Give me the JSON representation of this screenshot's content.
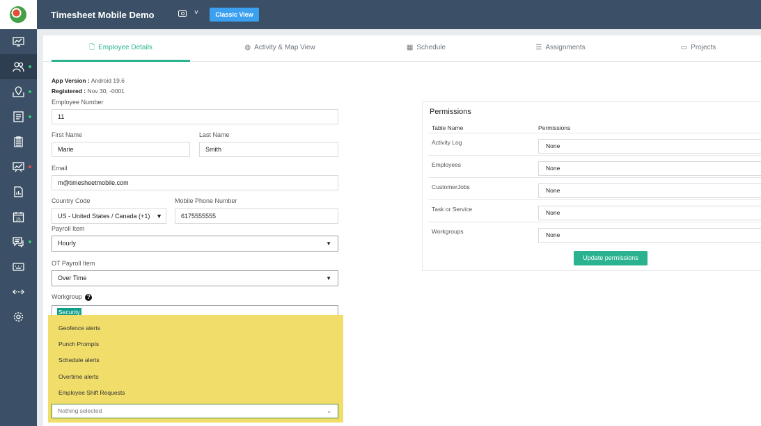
{
  "header": {
    "app_title": "Timesheet Mobile Demo",
    "caret": "˅",
    "classic_view_label": "Classic View"
  },
  "sidebar": {
    "items": [
      {
        "icon": "dashboard-icon",
        "dot": null
      },
      {
        "icon": "employees-icon",
        "dot": "#2ecc71",
        "active": true
      },
      {
        "icon": "map-icon",
        "dot": "#2ecc71"
      },
      {
        "icon": "documents-icon",
        "dot": "#2ecc71"
      },
      {
        "icon": "clipboard-icon",
        "dot": null
      },
      {
        "icon": "chart-icon",
        "dot": "#e84c4c"
      },
      {
        "icon": "report-icon",
        "dot": null
      },
      {
        "icon": "calendar-icon",
        "dot": null
      },
      {
        "icon": "messages-icon",
        "dot": "#2ecc71"
      },
      {
        "icon": "keyboard-icon",
        "dot": null
      },
      {
        "icon": "transfer-icon",
        "dot": null
      },
      {
        "icon": "settings-icon",
        "dot": null
      }
    ],
    "calendar_number": "15"
  },
  "tabs": [
    {
      "label": "Employee Details",
      "icon": "document-icon",
      "active": true
    },
    {
      "label": "Activity & Map View",
      "icon": "globe-icon",
      "active": false
    },
    {
      "label": "Schedule",
      "icon": "calendar-icon",
      "active": false
    },
    {
      "label": "Assignments",
      "icon": "list-icon",
      "active": false
    },
    {
      "label": "Projects",
      "icon": "projects-icon",
      "active": false
    }
  ],
  "employee": {
    "app_version_label": "App Version :",
    "app_version_value": "Android 19.6",
    "registered_label": "Registered :",
    "registered_value": "Nov 30, -0001",
    "employee_number_label": "Employee Number",
    "employee_number_value": "11",
    "first_name_label": "First Name",
    "first_name_value": "Marie",
    "last_name_label": "Last Name",
    "last_name_value": "Smith",
    "email_label": "Email",
    "email_value": "m@timesheetmobile.com",
    "country_code_label": "Country Code",
    "country_code_value": "US - United States / Canada (+1)",
    "mobile_label": "Mobile Phone Number",
    "mobile_value": "6175555555",
    "payroll_item_label": "Payroll Item",
    "payroll_item_value": "Hourly",
    "ot_payroll_item_label": "OT Payroll Item",
    "ot_payroll_item_value": "Over Time",
    "workgroup_label": "Workgroup",
    "workgroup_tag": "Security",
    "help_glyph": "?"
  },
  "alerts_dropdown": {
    "options": [
      "Geofence alerts",
      "Punch Prompts",
      "Schedule alerts",
      "Overtime alerts",
      "Employee Shift Requests"
    ],
    "selected_text": "Nothing selected",
    "highlight_color": "#f0dd6a"
  },
  "permissions": {
    "title": "Permissions",
    "col_table_name": "Table Name",
    "col_permissions": "Permissions",
    "rows": [
      {
        "name": "Activity Log",
        "value": "None"
      },
      {
        "name": "Employees",
        "value": "None"
      },
      {
        "name": "CustomerJobs",
        "value": "None"
      },
      {
        "name": "Task or Service",
        "value": "None"
      },
      {
        "name": "Workgroups",
        "value": "None"
      }
    ],
    "update_label": "Update permissions"
  },
  "colors": {
    "sidebar_bg": "#3b5066",
    "accent_green": "#2bb38f",
    "classic_blue": "#3ba0f0"
  }
}
